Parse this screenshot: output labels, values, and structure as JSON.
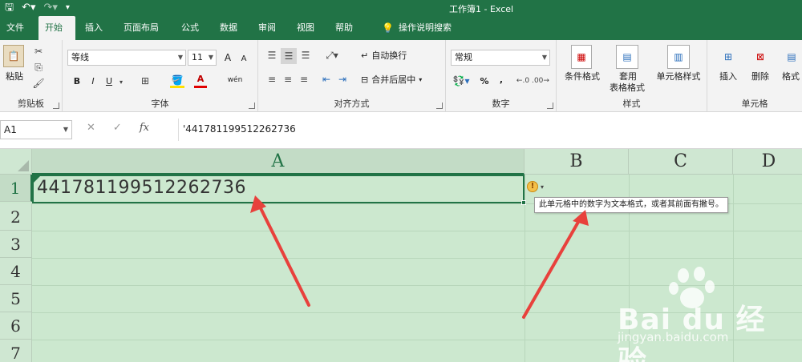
{
  "window": {
    "title": "工作簿1  -  Excel"
  },
  "qat": {
    "save_icon": "save-icon",
    "undo_icon": "undo-icon",
    "redo_icon": "redo-icon",
    "customize_icon": "qat-customize-icon"
  },
  "tabs": [
    "文件",
    "开始",
    "插入",
    "页面布局",
    "公式",
    "数据",
    "审阅",
    "视图",
    "帮助"
  ],
  "tell_me": "操作说明搜索",
  "ribbon": {
    "clipboard": {
      "label": "剪贴板",
      "paste": "粘贴"
    },
    "font": {
      "label": "字体",
      "name": "等线",
      "size": "11",
      "grow": "A",
      "shrink": "A",
      "bold": "B",
      "italic": "I",
      "underline": "U",
      "font_color_letter": "A",
      "phonetic": "wén"
    },
    "alignment": {
      "label": "对齐方式",
      "wrap": "自动换行",
      "merge": "合并后居中"
    },
    "number": {
      "label": "数字",
      "format": "常规",
      "percent": "%",
      "comma": ","
    },
    "styles": {
      "label": "样式",
      "conditional": "条件格式",
      "table_line1": "套用",
      "table_line2": "表格格式",
      "cell_styles": "单元格样式"
    },
    "cells": {
      "label": "单元格",
      "insert": "插入",
      "delete": "删除",
      "format": "格式"
    }
  },
  "formula_bar": {
    "name_box": "A1",
    "fx": "fx",
    "content": "'441781199512262736"
  },
  "grid": {
    "columns": [
      "A",
      "B",
      "C",
      "D"
    ],
    "rows": [
      "1",
      "2",
      "3",
      "4",
      "5",
      "6",
      "7"
    ],
    "a1_value": "441781199512262736",
    "tooltip": "此单元格中的数字为文本格式，或者其前面有撇号。"
  },
  "watermark": {
    "brand": "Bai du 经验",
    "url": "jingyan.baidu.com"
  },
  "colors": {
    "accent": "#217346",
    "grid_bg": "#cce8cf",
    "arrow": "#e8413c"
  }
}
